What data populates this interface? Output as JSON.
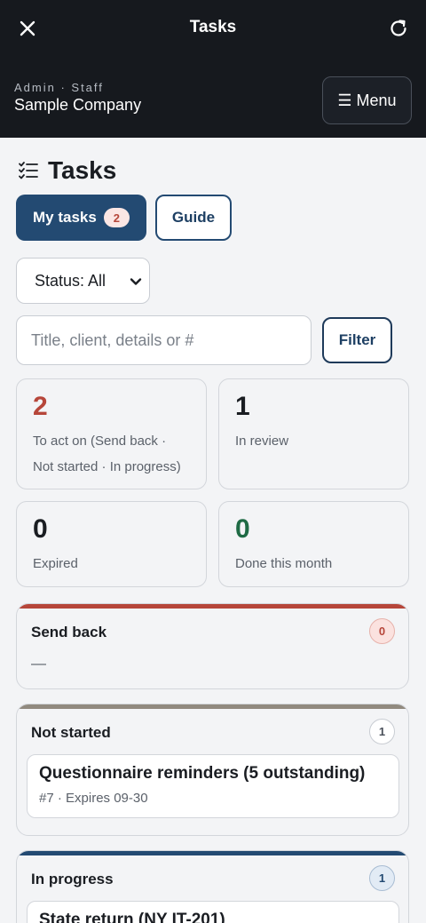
{
  "topbar": {
    "title": "Tasks"
  },
  "company": {
    "roles": "Admin · Staff",
    "name": "Sample Company",
    "menu_label": "☰ Menu"
  },
  "page": {
    "title": "Tasks"
  },
  "tabs": [
    {
      "label": "My tasks",
      "badge": "2"
    },
    {
      "label": "Guide"
    }
  ],
  "filters": {
    "status_options": [
      "Status: All"
    ],
    "status_selected": "Status: All",
    "search_placeholder": "Title, client, details or #",
    "search_value": "",
    "filter_label": "Filter"
  },
  "stats": [
    {
      "value": "2",
      "label": "To act on (Send back · Not started · In progress)",
      "color": "#b6463a"
    },
    {
      "value": "1",
      "label": "In review",
      "color": "#1a1d22"
    },
    {
      "value": "0",
      "label": "Expired",
      "color": "#1a1d22"
    },
    {
      "value": "0",
      "label": "Done this month",
      "color": "#1f6b45"
    }
  ],
  "sections": [
    {
      "title": "Send back",
      "count": "0",
      "empty_text": "—",
      "accent": "#b6463a"
    },
    {
      "title": "Not started",
      "count": "1",
      "accent": "#918a7f",
      "tasks": [
        {
          "title": "Questionnaire reminders (5 outstanding)",
          "meta": "#7 · Expires 09-30"
        }
      ]
    },
    {
      "title": "In progress",
      "count": "1",
      "accent": "#234a72",
      "tasks": [
        {
          "title": "State return (NY IT-201)",
          "meta": ""
        }
      ]
    }
  ]
}
